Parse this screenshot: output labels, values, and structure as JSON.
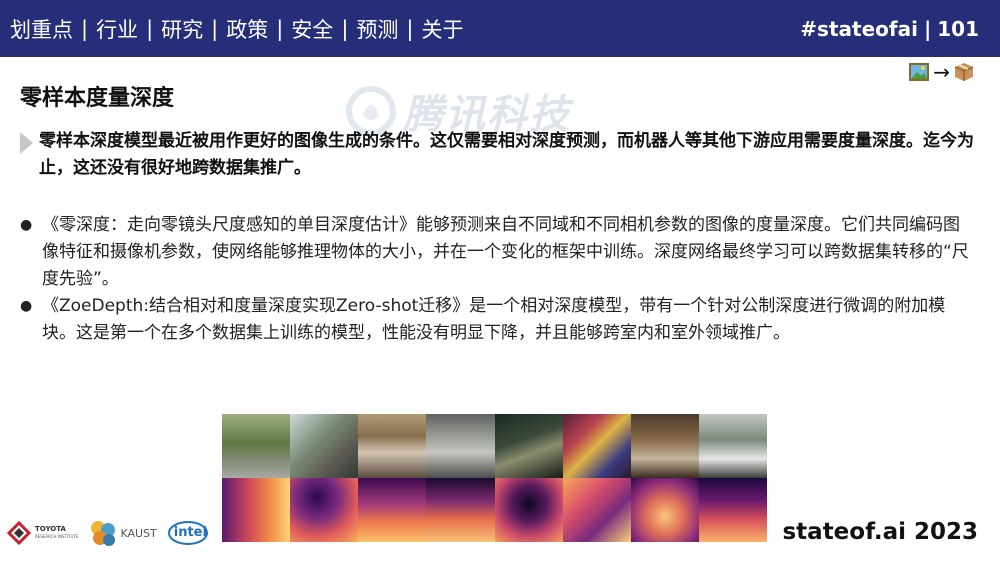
{
  "nav": {
    "items": [
      "划重点",
      "行业",
      "研究",
      "政策",
      "安全",
      "预测",
      "关于"
    ],
    "separator": "|"
  },
  "brand": {
    "tag": "#stateofai",
    "page": "101"
  },
  "watermark": "腾讯科技",
  "slide": {
    "title": "零样本度量深度",
    "flow_arrow": "→",
    "lead": "零样本深度模型最近被用作更好的图像生成的条件。这仅需要相对深度预测，而机器人等其他下游应用需要度量深度。迄今为止，这还没有很好地跨数据集推广。",
    "bullets": [
      "《零深度：走向零镜头尺度感知的单目深度估计》能够预测来自不同域和不同相机参数的图像的度量深度。它们共同编码图像特征和摄像机参数，使网络能够推理物体的大小，并在一个变化的框架中训练。深度网络最终学习可以跨数据集转移的“尺度先验”。",
      "《ZoeDepth:结合相对和度量深度实现Zero-shot迁移》是一个相对深度模型，带有一个针对公制深度进行微调的附加模块。这是第一个在多个数据集上训练的模型，性能没有明显下降，并且能够跨室内和室外领域推广。"
    ],
    "bullet_marker": "●"
  },
  "logos": {
    "toyota": "TOYOTA",
    "toyota_sub": "RESEARCH INSTITUTE",
    "kaust": "KAUST",
    "intel": "intel"
  },
  "footer": {
    "brand": "stateof.ai 2023"
  },
  "colors": {
    "topbar": "#262d79",
    "text": "#111111"
  },
  "icons": [
    "image-icon",
    "arrow-icon",
    "package-icon",
    "toyota-logo-icon",
    "kaust-logo-icon",
    "intel-logo-icon"
  ]
}
